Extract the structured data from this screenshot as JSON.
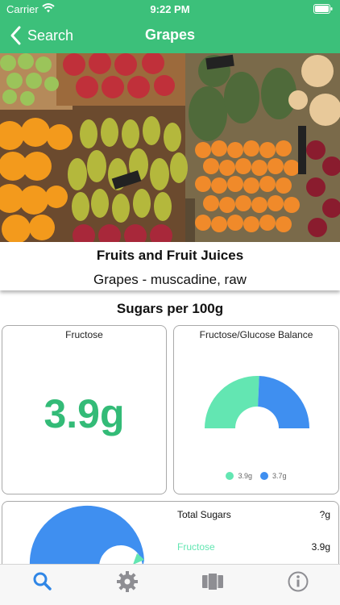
{
  "status_bar": {
    "carrier": "Carrier",
    "time": "9:22 PM"
  },
  "nav": {
    "back_label": "Search",
    "title": "Grapes"
  },
  "food": {
    "category": "Fruits and Fruit Juices",
    "name": "Grapes - muscadine, raw"
  },
  "section_title": "Sugars per 100g",
  "fructose_card": {
    "title": "Fructose",
    "value": "3.9g"
  },
  "balance_card": {
    "title": "Fructose/Glucose Balance",
    "legend": [
      {
        "label": "3.9g",
        "color": "#63e6b2"
      },
      {
        "label": "3.7g",
        "color": "#3f8ff0"
      }
    ]
  },
  "total_card": {
    "title": "Total Sugars",
    "total_value": "?g",
    "rows": [
      {
        "label": "Fructose",
        "value": "3.9g"
      }
    ]
  },
  "tabs": [
    {
      "icon": "search-icon",
      "active": true
    },
    {
      "icon": "gear-icon",
      "active": false
    },
    {
      "icon": "film-strip-icon",
      "active": false
    },
    {
      "icon": "info-icon",
      "active": false
    }
  ],
  "chart_data": {
    "type": "pie",
    "title": "Fructose/Glucose Balance",
    "categories": [
      "Fructose",
      "Glucose"
    ],
    "values": [
      3.9,
      3.7
    ],
    "colors": [
      "#63e6b2",
      "#3f8ff0"
    ],
    "units": "g"
  },
  "colors": {
    "accent": "#3cc07a",
    "value_green": "#33bb77",
    "fructose": "#63e6b2",
    "glucose": "#3f8ff0",
    "tab_active": "#2f86e6",
    "tab_inactive": "#8e8e93"
  }
}
